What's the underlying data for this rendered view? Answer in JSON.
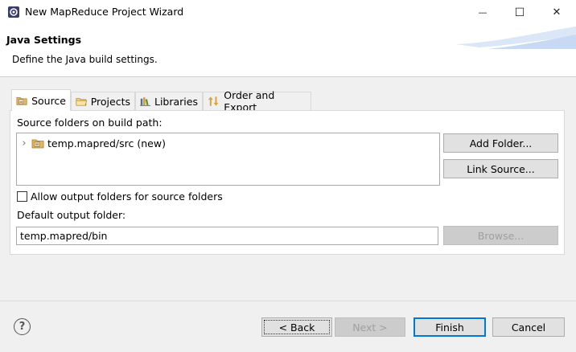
{
  "window": {
    "title": "New MapReduce Project Wizard",
    "minimize_glyph": "—",
    "maximize_glyph": "☐",
    "close_glyph": "✕"
  },
  "banner": {
    "title": "Java Settings",
    "description": "Define the Java build settings."
  },
  "tabs": [
    {
      "label": "Source",
      "icon": "source-folder-icon",
      "active": true
    },
    {
      "label": "Projects",
      "icon": "projects-icon",
      "active": false
    },
    {
      "label": "Libraries",
      "icon": "libraries-icon",
      "active": false
    },
    {
      "label": "Order and Export",
      "icon": "order-export-icon",
      "active": false
    }
  ],
  "source": {
    "folders_label": "Source folders on build path:",
    "tree_items": [
      {
        "label": "temp.mapred/src (new)",
        "icon": "source-folder-icon",
        "expand_glyph": "›"
      }
    ],
    "add_folder_label": "Add Folder...",
    "link_source_label": "Link Source...",
    "allow_output_label": "Allow output folders for source folders",
    "allow_output_checked": false,
    "default_output_label": "Default output folder:",
    "default_output_value": "temp.mapred/bin",
    "browse_label": "Browse..."
  },
  "footer": {
    "help_glyph": "?",
    "back_label": "< Back",
    "next_label": "Next >",
    "finish_label": "Finish",
    "cancel_label": "Cancel"
  },
  "colors": {
    "accent": "#0078d7",
    "folder": "#d9a23a",
    "banner_swoosh": "#c7d9f3"
  }
}
